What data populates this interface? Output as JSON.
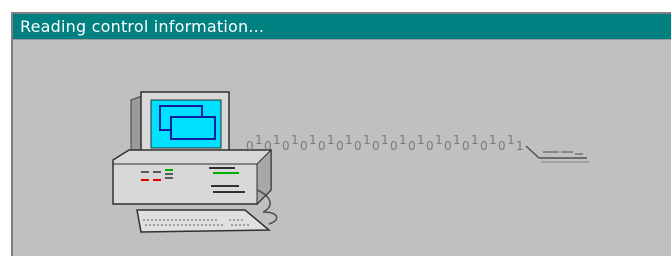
{
  "window": {
    "title": "Reading control information..."
  },
  "animation": {
    "binary_stream": [
      "0",
      "1",
      "0",
      "1",
      "0",
      "1",
      "0",
      "1",
      "0",
      "1",
      "0",
      "1",
      "0",
      "1",
      "0",
      "1",
      "0",
      "1",
      "0",
      "1",
      "0",
      "1",
      "0",
      "1",
      "0",
      "1",
      "0",
      "1",
      "0",
      "1",
      "1"
    ],
    "icons": {
      "computer": "desktop-computer-icon",
      "destination": "device-icon"
    }
  },
  "colors": {
    "titlebar": "#008080",
    "title_text": "#ffffff",
    "window_bg": "#c0c0c0",
    "screen": "#00e0ff"
  }
}
